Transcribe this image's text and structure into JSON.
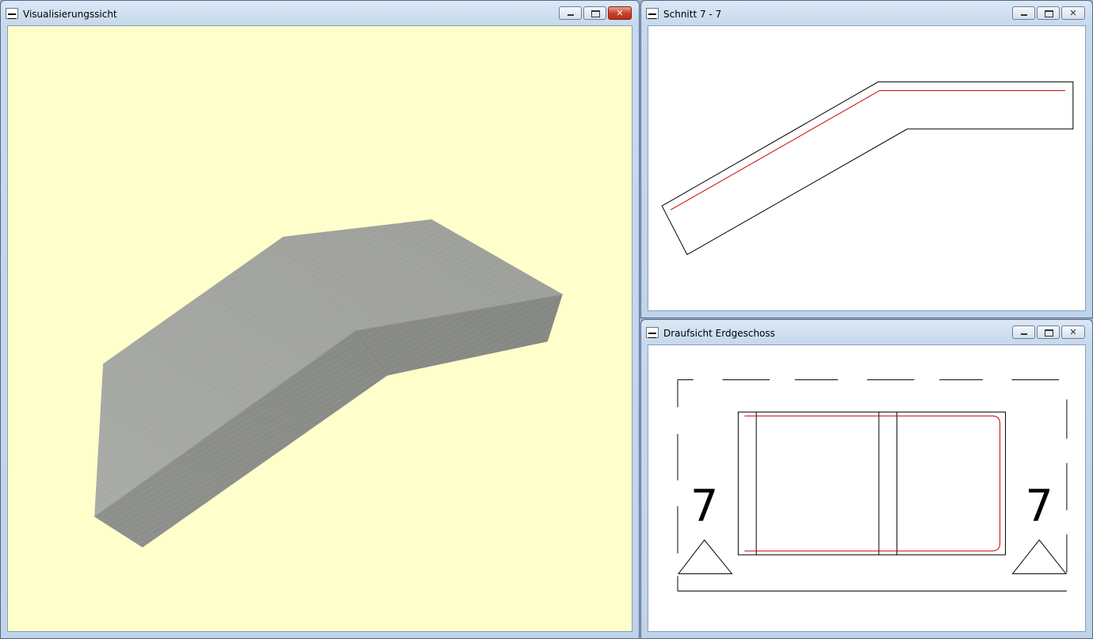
{
  "colors": {
    "viz_background": "#ffffcc",
    "drawing_background": "#ffffff",
    "line_color": "#000000",
    "rebar_color": "#cc0000",
    "block_top": "#a5a7a3",
    "block_front": "#8c8e8a",
    "block_side": "#7f817d"
  },
  "windows": {
    "visualization": {
      "title": "Visualisierungssicht",
      "icon": "viacad-app-icon",
      "close_active": true
    },
    "section": {
      "title": "Schnitt 7 - 7",
      "icon": "viacad-app-icon"
    },
    "plan": {
      "title": "Draufsicht Erdgeschoss",
      "icon": "viacad-app-icon",
      "section_marker_left": "7",
      "section_marker_right": "7"
    }
  }
}
